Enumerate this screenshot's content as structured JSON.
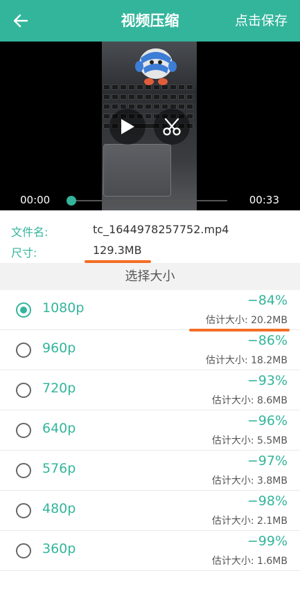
{
  "header": {
    "title": "视频压缩",
    "save_label": "点击保存"
  },
  "player": {
    "current_time": "00:00",
    "duration": "00:33",
    "progress_fraction": 0.0
  },
  "file_info": {
    "name_label": "文件名:",
    "name_value": "tc_1644978257752.mp4",
    "size_label": "尺寸:",
    "size_value": "129.3MB"
  },
  "section_title": "选择大小",
  "options": [
    {
      "res": "1080p",
      "pct": "−84%",
      "est": "估计大小: 20.2MB",
      "selected": true
    },
    {
      "res": "960p",
      "pct": "−86%",
      "est": "估计大小: 18.2MB",
      "selected": false
    },
    {
      "res": "720p",
      "pct": "−93%",
      "est": "估计大小: 8.6MB",
      "selected": false
    },
    {
      "res": "640p",
      "pct": "−96%",
      "est": "估计大小: 5.5MB",
      "selected": false
    },
    {
      "res": "576p",
      "pct": "−97%",
      "est": "估计大小: 3.8MB",
      "selected": false
    },
    {
      "res": "480p",
      "pct": "−98%",
      "est": "估计大小: 2.1MB",
      "selected": false
    },
    {
      "res": "360p",
      "pct": "−99%",
      "est": "估计大小: 1.6MB",
      "selected": false
    }
  ],
  "colors": {
    "accent": "#33b59c",
    "highlight": "#f36d23"
  },
  "icons": [
    "back-arrow-icon",
    "play-icon",
    "scissors-icon"
  ]
}
